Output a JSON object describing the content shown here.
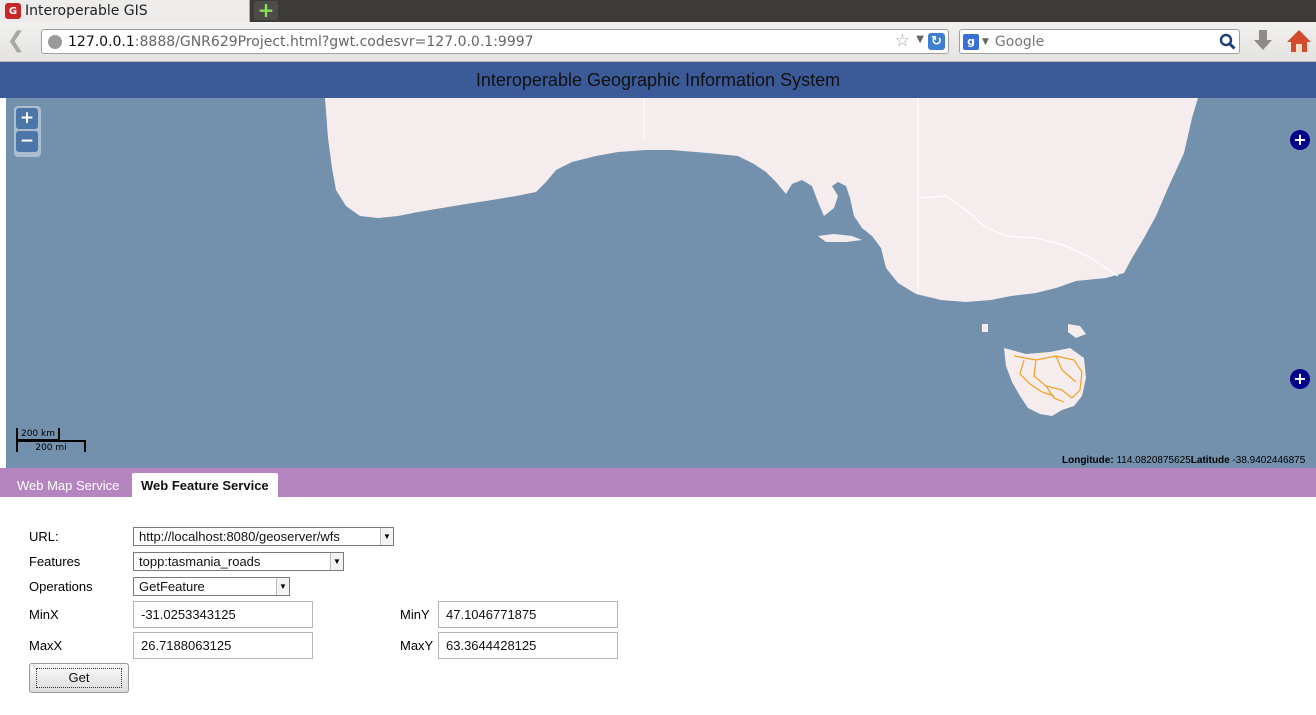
{
  "browser": {
    "tab_title": "Interoperable GIS",
    "url_host": "127.0.0.1",
    "url_rest": ":8888/GNR629Project.html?gwt.codesvr=127.0.0.1:9997",
    "search_placeholder": "Google"
  },
  "app": {
    "title": "Interoperable Geographic Information System"
  },
  "map": {
    "zoom_in": "+",
    "zoom_out": "−",
    "scale_metric": "200 km",
    "scale_imperial": "200 mi",
    "longitude_label": "Longitude:",
    "longitude_value": "114.0820875625",
    "latitude_label": "Latitude",
    "latitude_value": "-38.9402446875",
    "ocean_color": "#7391ad",
    "land_color": "#f5eded",
    "roads_color": "#f0a020"
  },
  "tabs": [
    {
      "label": "Web Map Service",
      "active": false
    },
    {
      "label": "Web Feature Service",
      "active": true
    }
  ],
  "form": {
    "url_label": "URL:",
    "url_value": "http://localhost:8080/geoserver/wfs",
    "features_label": "Features",
    "features_value": "topp:tasmania_roads",
    "operations_label": "Operations",
    "operations_value": "GetFeature",
    "minx_label": "MinX",
    "minx_value": "-31.0253343125",
    "miny_label": "MinY",
    "miny_value": "47.1046771875",
    "maxx_label": "MaxX",
    "maxx_value": "26.7188063125",
    "maxy_label": "MaxY",
    "maxy_value": "63.3644428125",
    "get_label": "Get"
  }
}
